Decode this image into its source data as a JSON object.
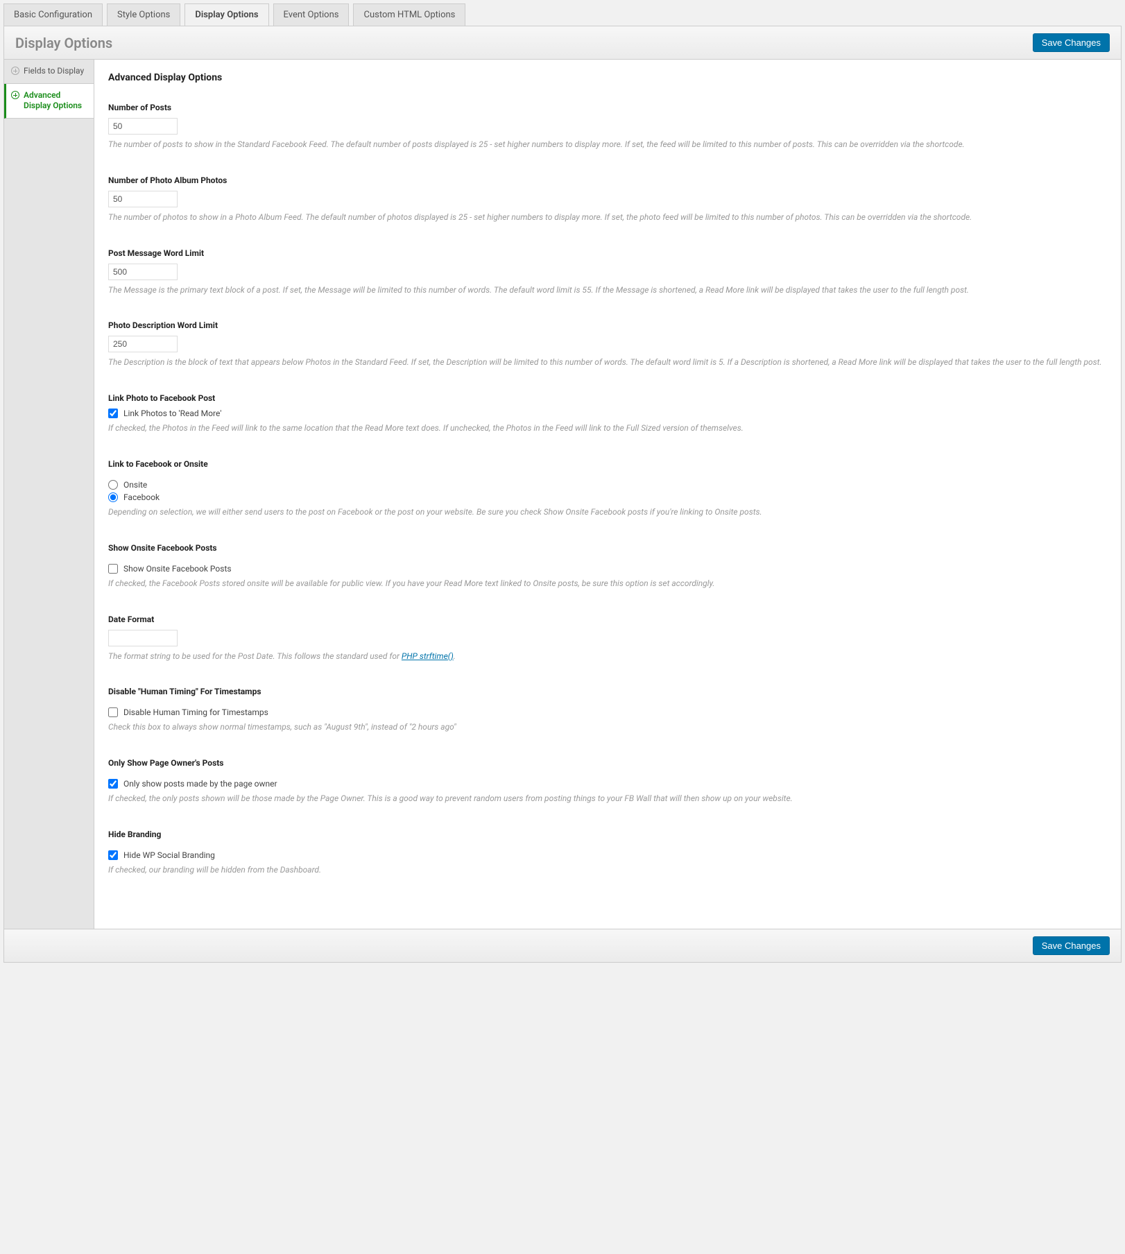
{
  "tabs": {
    "basic": "Basic Configuration",
    "style": "Style Options",
    "display": "Display Options",
    "event": "Event Options",
    "custom": "Custom HTML Options"
  },
  "panel": {
    "title": "Display Options",
    "saveBtn": "Save Changes"
  },
  "sidebar": {
    "fields": "Fields to Display",
    "advanced": "Advanced Display Options"
  },
  "main": {
    "heading": "Advanced Display Options",
    "numPosts": {
      "title": "Number of Posts",
      "value": "50",
      "desc": "The number of posts to show in the Standard Facebook Feed. The default number of posts displayed is 25 - set higher numbers to display more. If set, the feed will be limited to this number of posts. This can be overridden via the shortcode."
    },
    "numPhotos": {
      "title": "Number of Photo Album Photos",
      "value": "50",
      "desc": "The number of photos to show in a Photo Album Feed. The default number of photos displayed is 25 - set higher numbers to display more. If set, the photo feed will be limited to this number of photos. This can be overridden via the shortcode."
    },
    "wordLimit": {
      "title": "Post Message Word Limit",
      "value": "500",
      "desc": "The Message is the primary text block of a post. If set, the Message will be limited to this number of words. The default word limit is 55. If the Message is shortened, a Read More link will be displayed that takes the user to the full length post."
    },
    "photoDesc": {
      "title": "Photo Description Word Limit",
      "value": "250",
      "desc": "The Description is the block of text that appears below Photos in the Standard Feed. If set, the Description will be limited to this number of words. The default word limit is 5. If a Description is shortened, a Read More link will be displayed that takes the user to the full length post."
    },
    "linkPhoto": {
      "title": "Link Photo to Facebook Post",
      "checkLabel": "Link Photos to 'Read More'",
      "desc": "If checked, the Photos in the Feed will link to the same location that the Read More text does. If unchecked, the Photos in the Feed will link to the Full Sized version of themselves."
    },
    "linkTo": {
      "title": "Link to Facebook or Onsite",
      "opt1": "Onsite",
      "opt2": "Facebook",
      "desc": "Depending on selection, we will either send users to the post on Facebook or the post on your website. Be sure you check Show Onsite Facebook posts if you're linking to Onsite posts."
    },
    "showOnsite": {
      "title": "Show Onsite Facebook Posts",
      "checkLabel": "Show Onsite Facebook Posts",
      "desc": "If checked, the Facebook Posts stored onsite will be available for public view. If you have your Read More text linked to Onsite posts, be sure this option is set accordingly."
    },
    "dateFormat": {
      "title": "Date Format",
      "value": "",
      "descPrefix": "The format string to be used for the Post Date. This follows the standard used for ",
      "linkText": "PHP strftime()",
      "descSuffix": "."
    },
    "disableHuman": {
      "title": "Disable \"Human Timing\" For Timestamps",
      "checkLabel": "Disable Human Timing for Timestamps",
      "desc": "Check this box to always show normal timestamps, such as \"August 9th\", instead of \"2 hours ago\""
    },
    "onlyOwner": {
      "title": "Only Show Page Owner's Posts",
      "checkLabel": "Only show posts made by the page owner",
      "desc": "If checked, the only posts shown will be those made by the Page Owner. This is a good way to prevent random users from posting things to your FB Wall that will then show up on your website."
    },
    "hideBranding": {
      "title": "Hide Branding",
      "checkLabel": "Hide WP Social Branding",
      "desc": "If checked, our branding will be hidden from the Dashboard."
    }
  }
}
